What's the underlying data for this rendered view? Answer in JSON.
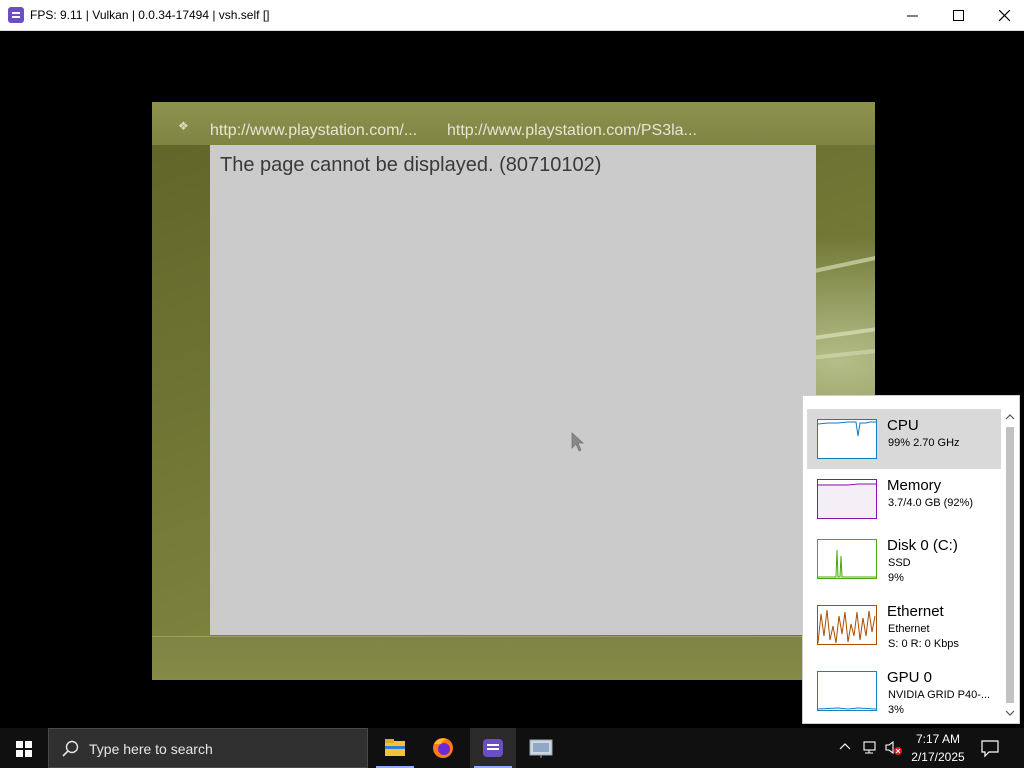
{
  "window": {
    "title": "FPS: 9.11 | Vulkan | 0.0.34-17494 | vsh.self []"
  },
  "emulator": {
    "url_left": "http://www.playstation.com/...",
    "url_right": "http://www.playstation.com/PS3la...",
    "page_message": "The page cannot be displayed. (80710102)"
  },
  "perf_panel": {
    "items": [
      {
        "name": "CPU",
        "sub1": "99%  2.70 GHz",
        "sub2": "",
        "sub3": "",
        "color": "#117dbb",
        "selected": true
      },
      {
        "name": "Memory",
        "sub1": "3.7/4.0 GB (92%)",
        "sub2": "",
        "sub3": "",
        "color": "#8b12ae",
        "selected": false
      },
      {
        "name": "Disk 0 (C:)",
        "sub1": "SSD",
        "sub2": "9%",
        "sub3": "",
        "color": "#4da60c",
        "selected": false
      },
      {
        "name": "Ethernet",
        "sub1": "Ethernet",
        "sub2": "S: 0 R: 0 Kbps",
        "sub3": "",
        "color": "#a74f01",
        "selected": false
      },
      {
        "name": "GPU 0",
        "sub1": "NVIDIA GRID P40-...",
        "sub2": "3%",
        "sub3": "",
        "color": "#1581c4",
        "selected": false
      }
    ]
  },
  "taskbar": {
    "search_placeholder": "Type here to search",
    "apps": [
      "file-explorer-icon",
      "firefox-icon",
      "rpcs3-icon",
      "network-app-icon"
    ],
    "clock_time": "7:17 AM",
    "clock_date": "2/17/2025"
  },
  "colors": {
    "accent": "#8cb0ff",
    "viewport_olive": "#6f7634",
    "page_grey": "#cbcbcb"
  }
}
